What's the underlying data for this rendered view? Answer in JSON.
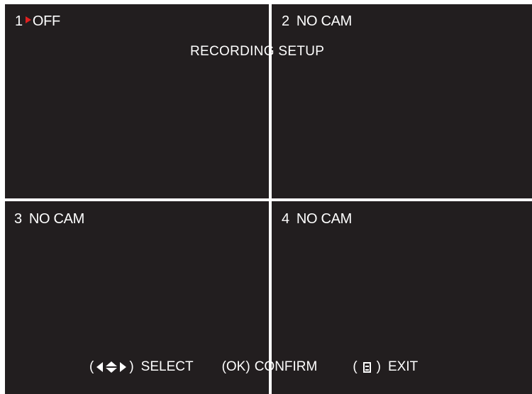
{
  "screen": {
    "title": "RECORDING SETUP",
    "background_color": "#221e1f",
    "divider_color": "#ffffff",
    "pointer_color": "#e02020"
  },
  "channels": [
    {
      "number": "1",
      "status": "OFF",
      "selected": true
    },
    {
      "number": "2",
      "status": "NO CAM",
      "selected": false
    },
    {
      "number": "3",
      "status": "NO CAM",
      "selected": false
    },
    {
      "number": "4",
      "status": "NO CAM",
      "selected": false
    }
  ],
  "footer": {
    "select": {
      "open": "(",
      "close": ")",
      "label": "SELECT",
      "icon": "arrow-keys-icon"
    },
    "confirm": {
      "open": "(",
      "key": "OK",
      "close": ")",
      "label": "CONFIRM"
    },
    "exit": {
      "open": "(",
      "close": ")",
      "label": "EXIT",
      "icon": "menu-icon"
    }
  }
}
